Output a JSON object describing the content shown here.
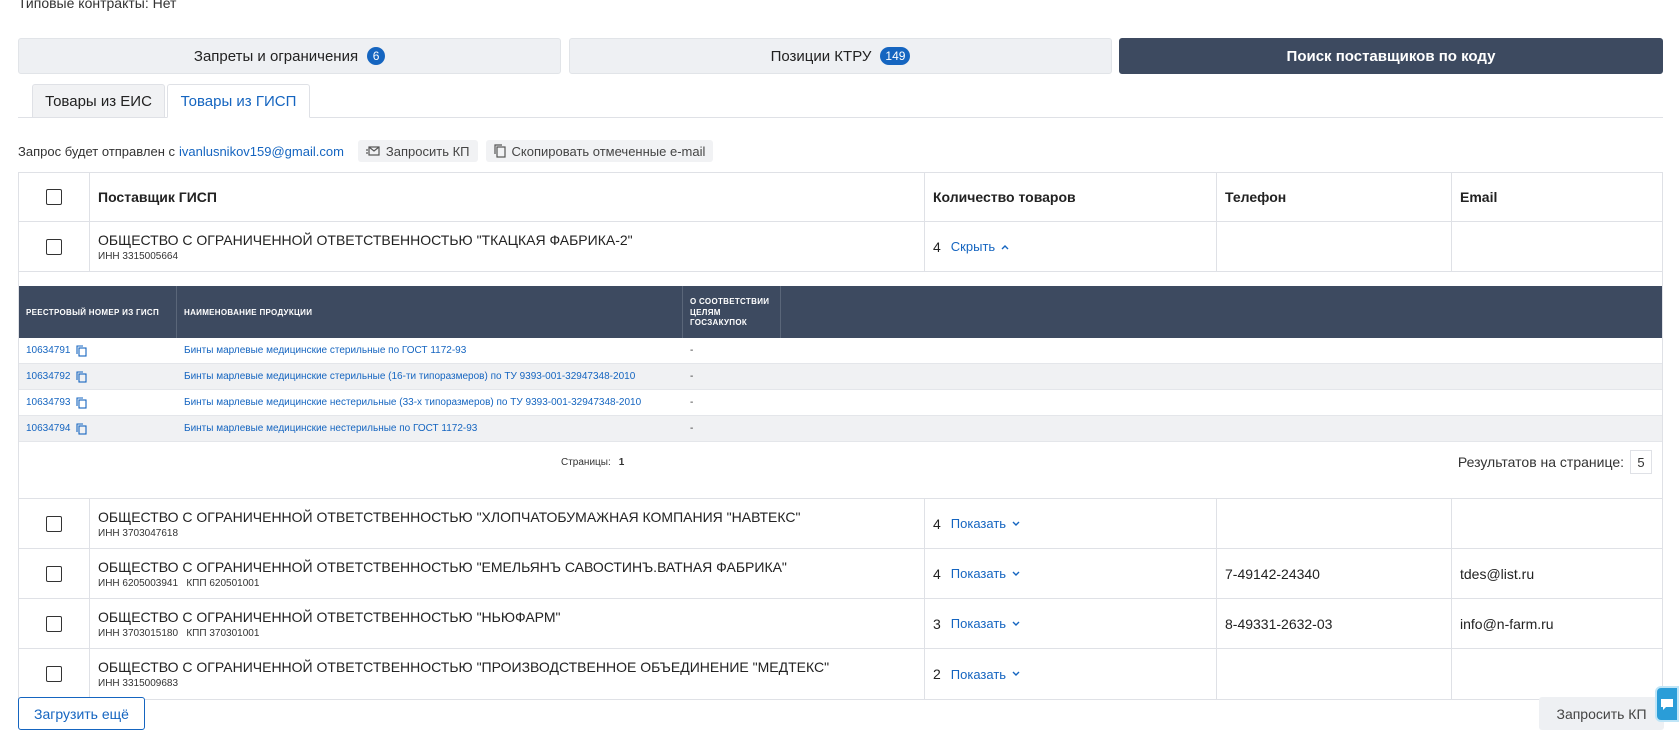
{
  "top_text": "Типовые контракты: Нет",
  "big_tabs": [
    {
      "label": "Запреты и ограничения",
      "badge": "6"
    },
    {
      "label": "Позиции КТРУ",
      "badge": "149"
    },
    {
      "label": "Поиск поставщиков по коду",
      "badge": null
    }
  ],
  "sub_tabs": [
    {
      "label": "Товары из ЕИС"
    },
    {
      "label": "Товары из ГИСП"
    }
  ],
  "request": {
    "prefix": "Запрос будет отправлен с",
    "email": "ivanlusnikov159@gmail.com",
    "request_kp": "Запросить КП",
    "copy_emails": "Скопировать отмеченные e-mail"
  },
  "table": {
    "headers": {
      "supplier": "Поставщик ГИСП",
      "qty": "Количество товаров",
      "phone": "Телефон",
      "email": "Email"
    },
    "rows": [
      {
        "name": "ОБЩЕСТВО С ОГРАНИЧЕННОЙ ОТВЕТСТВЕННОСТЬЮ \"ТКАЦКАЯ ФАБРИКА-2\"",
        "ids": "ИНН 3315005664",
        "qty": "4",
        "toggle": "Скрыть",
        "phone": "",
        "email": ""
      },
      {
        "name": "ОБЩЕСТВО С ОГРАНИЧЕННОЙ ОТВЕТСТВЕННОСТЬЮ \"ХЛОПЧАТОБУМАЖНАЯ КОМПАНИЯ \"НАВТЕКС\"",
        "ids": "ИНН 3703047618",
        "qty": "4",
        "toggle": "Показать",
        "phone": "",
        "email": ""
      },
      {
        "name": "ОБЩЕСТВО С ОГРАНИЧЕННОЙ ОТВЕТСТВЕННОСТЬЮ \"ЕМЕЛЬЯНЪ САВОСТИНЪ.ВАТНАЯ ФАБРИКА\"",
        "ids": "ИНН 6205003941   КПП 620501001",
        "qty": "4",
        "toggle": "Показать",
        "phone": "7-49142-24340",
        "email": "tdes@list.ru"
      },
      {
        "name": "ОБЩЕСТВО С ОГРАНИЧЕННОЙ ОТВЕТСТВЕННОСТЬЮ \"НЬЮФАРМ\"",
        "ids": "ИНН 3703015180   КПП 370301001",
        "qty": "3",
        "toggle": "Показать",
        "phone": "8-49331-2632-03",
        "email": "info@n-farm.ru"
      },
      {
        "name": "ОБЩЕСТВО С ОГРАНИЧЕННОЙ ОТВЕТСТВЕННОСТЬЮ \"ПРОИЗВОДСТВЕННОЕ ОБЪЕДИНЕНИЕ \"МЕДТЕКС\"",
        "ids": "ИНН 3315009683",
        "qty": "2",
        "toggle": "Показать",
        "phone": "",
        "email": ""
      }
    ]
  },
  "sub_table": {
    "headers": {
      "reg": "Реестровый номер из ГИСП",
      "name": "Наименование продукции",
      "conformity": "О соответствии целям госзакупок"
    },
    "rows": [
      {
        "reg": "10634791",
        "name": "Бинты марлевые медицинские стерильные по ГОСТ 1172-93",
        "conf": "-"
      },
      {
        "reg": "10634792",
        "name": "Бинты марлевые медицинские стерильные (16-ти типоразмеров) по ТУ 9393-001-32947348-2010",
        "conf": "-"
      },
      {
        "reg": "10634793",
        "name": "Бинты марлевые медицинские нестерильные (33-х типоразмеров) по ТУ 9393-001-32947348-2010",
        "conf": "-"
      },
      {
        "reg": "10634794",
        "name": "Бинты марлевые медицинские нестерильные по ГОСТ 1172-93",
        "conf": "-"
      }
    ],
    "pages_label": "Страницы:",
    "page": "1",
    "per_page_label": "Результатов на странице:",
    "per_page": "5"
  },
  "footer": {
    "load_more": "Загрузить ещё",
    "request_kp": "Запросить КП"
  },
  "colors": {
    "accent": "#1565c0",
    "dark": "#3d4a60"
  }
}
